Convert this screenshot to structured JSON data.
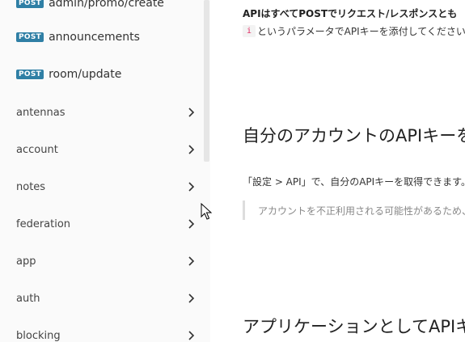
{
  "sidebar": {
    "endpoints": [
      {
        "method": "POST",
        "path": "admin/promo/create"
      },
      {
        "method": "POST",
        "path": "announcements"
      },
      {
        "method": "POST",
        "path": "room/update"
      }
    ],
    "groups": [
      {
        "label": "antennas",
        "icon": "chevron-right-icon"
      },
      {
        "label": "account",
        "icon": "chevron-right-icon"
      },
      {
        "label": "notes",
        "icon": "chevron-right-icon"
      },
      {
        "label": "federation",
        "icon": "chevron-right-icon"
      },
      {
        "label": "app",
        "icon": "chevron-right-icon"
      },
      {
        "label": "auth",
        "icon": "chevron-right-icon"
      },
      {
        "label": "blocking",
        "icon": "chevron-right-icon"
      }
    ]
  },
  "content": {
    "intro_bold": "APIはすべてPOSTでリクエスト/レスポンスとも",
    "param_code": "i",
    "param_text": "というパラメータでAPIキーを添付してください。",
    "heading_apikey": "自分のアカウントのAPIキーを取得",
    "apikey_text": "「設定 > API」で、自分のAPIキーを取得できます。",
    "apikey_warning": "アカウントを不正利用される可能性があるため、",
    "heading_app": "アプリケーションとしてAPIキーを取得"
  },
  "colors": {
    "post_badge": "#2f7fa5",
    "code_text": "#e0245e",
    "sidebar_bg": "#fafafa"
  }
}
